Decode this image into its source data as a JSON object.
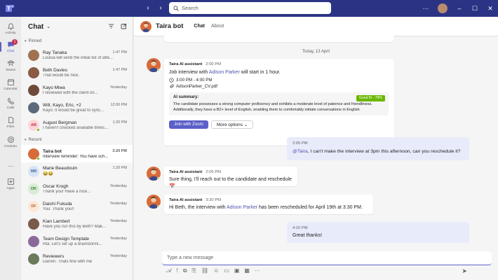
{
  "titlebar": {
    "search_placeholder": "Search",
    "back_icon": "chevron-left-icon",
    "forward_icon": "chevron-right-icon",
    "more_label": "···",
    "minimize": "–",
    "maximize": "☐",
    "close": "✕"
  },
  "rail": {
    "items": [
      {
        "label": "Activity",
        "icon": "bell-icon"
      },
      {
        "label": "Chat",
        "icon": "chat-icon",
        "badge": "1"
      },
      {
        "label": "Teams",
        "icon": "teams-icon"
      },
      {
        "label": "Calendar",
        "icon": "calendar-icon"
      },
      {
        "label": "Calls",
        "icon": "phone-icon"
      },
      {
        "label": "Files",
        "icon": "file-icon"
      },
      {
        "label": "Contoso",
        "icon": "contoso-icon"
      },
      {
        "label": "···",
        "icon": "more-icon"
      },
      {
        "label": "Apps",
        "icon": "apps-icon"
      }
    ]
  },
  "panel": {
    "title": "Chat",
    "pinned_label": "Pinned",
    "recent_label": "Recent",
    "pinned": [
      {
        "name": "Ray Tanaka",
        "time": "1:47 PM",
        "msg": "Louisa will send the initial list of atte...",
        "color": "#a0724f"
      },
      {
        "name": "Beth Davies",
        "time": "1:47 PM",
        "msg": "That would be nice.",
        "color": "#8a5a44"
      },
      {
        "name": "Kayo Miwa",
        "time": "Yesterday",
        "msg": "I reviewed with the client on...",
        "color": "#6e4a3a"
      },
      {
        "name": "Will, Kayo, Eric, +2",
        "time": "12:00 PM",
        "msg": "Kayo: It would be great to sync...",
        "color": "#5a6a7a"
      },
      {
        "name": "August Bergman",
        "time": "1:20 PM",
        "msg": "I haven't checked available times...",
        "initials": "AB",
        "color": "#fbd7d7",
        "fg": "#c4314b"
      }
    ],
    "recent": [
      {
        "name": "Taira bot",
        "time": "3:20 PM",
        "msg": "Interview reminder: You have sch...",
        "color": "#d86b3a"
      },
      {
        "name": "Marie Beaudouin",
        "time": "1:20 PM",
        "msg": "😂😂",
        "initials": "MB",
        "color": "#d6e4f5",
        "fg": "#4a6a9a"
      },
      {
        "name": "Oscar Krogh",
        "time": "Yesterday",
        "msg": "Thank you! Have a nice...",
        "initials": "OK",
        "color": "#d8ecd4",
        "fg": "#3a7a3a"
      },
      {
        "name": "Daichi Fukuda",
        "time": "Yesterday",
        "msg": "You: Thank you!!",
        "initials": "DF",
        "color": "#fde7d7",
        "fg": "#b0673a"
      },
      {
        "name": "Kian Lambert",
        "time": "Yesterday",
        "msg": "Have you run this by Beth? Mak...",
        "color": "#7a5a4a"
      },
      {
        "name": "Team Design Template",
        "time": "Yesterday",
        "msg": "Rta: Let's set up a brainstormi...",
        "color": "#8a6a9a"
      },
      {
        "name": "Reviewers",
        "time": "Yesterday",
        "msg": "Darren: Thats fine with me",
        "color": "#6a7a5a"
      }
    ]
  },
  "header": {
    "title": "Taira bot",
    "tabs": [
      "Chat",
      "About"
    ]
  },
  "conversation": {
    "date": "Today, 13 April",
    "msg1": {
      "sender": "Taira AI assistant",
      "time": "2:00 PM",
      "text_pre": "Job interview with ",
      "link": "Adison Parker",
      "text_post": " will start in 1 hour.",
      "schedule": "3:00 PM - 4:00 PM",
      "file": "AdisonParker_CV.pdf",
      "ai_label": "AI summary:",
      "fit": "Good fit - 78%",
      "summary": "The candidate possesses a strong computer proficiency and exhibits a moderate level of patience and friendliness. Additionally, they have a B2+ level of English, enabling them to comfortably initiate conversations in English",
      "join": "Join with Zoom",
      "more": "More options"
    },
    "msg2": {
      "time": "2:05 PM",
      "mention": "@Taira",
      "text": ", I can't make the interview at 3pm this afternoon, can you reschedule it?"
    },
    "msg3": {
      "sender": "Taira AI assistant",
      "time": "2:05 PM",
      "text": "Sure thing, I'll reach out to the candidate and reschedule 📅"
    },
    "msg4": {
      "sender": "Taira AI assistant",
      "time": "3:20 PM",
      "text_pre": "Hi Beth, the interview with ",
      "link": "Adison Parker",
      "text_post": " has been rescheduled for April 19th at 3:30 PM."
    },
    "msg5": {
      "time": "4:10 PM",
      "text": "Great thanks!"
    }
  },
  "composer": {
    "placeholder": "Type a new message"
  }
}
